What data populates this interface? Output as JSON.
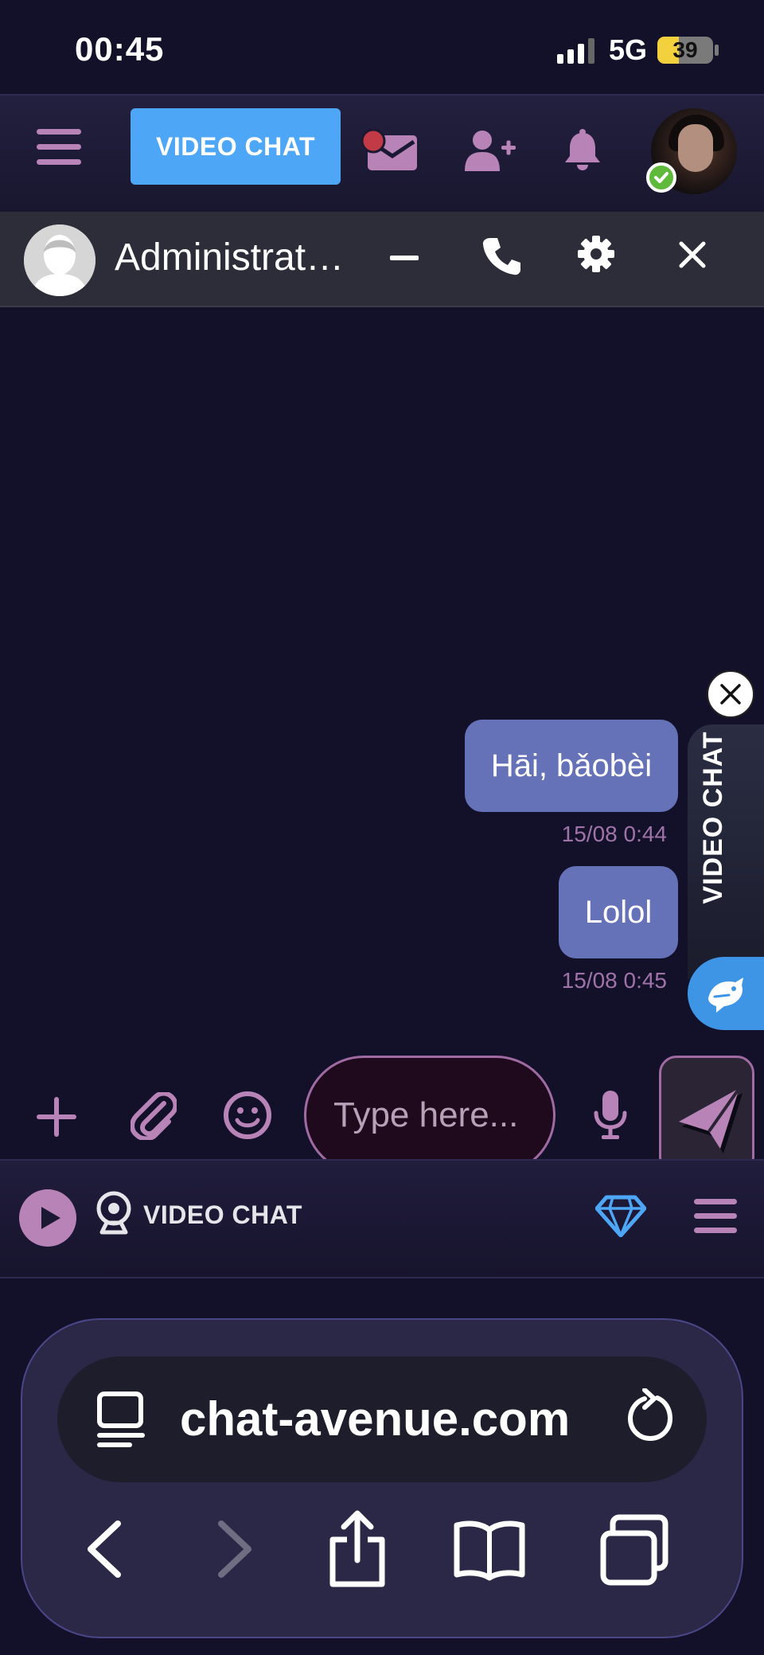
{
  "status_bar": {
    "time": "00:45",
    "network": "5G",
    "battery_level": 39,
    "battery_label": "39"
  },
  "top_nav": {
    "video_chat_label": "VIDEO CHAT",
    "icons": [
      "menu-icon",
      "mail-icon",
      "add-friend-icon",
      "bell-icon",
      "avatar",
      "online-check-icon"
    ]
  },
  "chat_header": {
    "name": "Administrat…",
    "icons": [
      "minimize-icon",
      "phone-icon",
      "gear-icon",
      "close-icon"
    ]
  },
  "messages": [
    {
      "text": "Hāi, bǎobèi",
      "time": "15/08 0:44"
    },
    {
      "text": "Lolol",
      "time": "15/08 0:45"
    }
  ],
  "side_promo": {
    "label": "VIDEO CHAT"
  },
  "composer": {
    "placeholder": "Type here...",
    "icons": [
      "plus-icon",
      "paperclip-icon",
      "emoji-icon",
      "mic-icon",
      "send-icon"
    ]
  },
  "site_bar": {
    "logo_text": "VIDEO CHAT",
    "icons": [
      "play-icon",
      "webcam-icon",
      "diamond-icon",
      "menu-icon"
    ]
  },
  "browser": {
    "url": "chat-avenue.com",
    "icons": [
      "reader-icon",
      "reload-icon",
      "back-icon",
      "forward-icon",
      "share-icon",
      "bookmarks-icon",
      "tabs-icon"
    ]
  },
  "colors": {
    "background": "#13112a",
    "accent_blue": "#4ea6f6",
    "bubble": "#6672b8",
    "icon_purple": "#b884b8",
    "online_green": "#5fb93b",
    "battery_yellow": "#f2d13c"
  }
}
